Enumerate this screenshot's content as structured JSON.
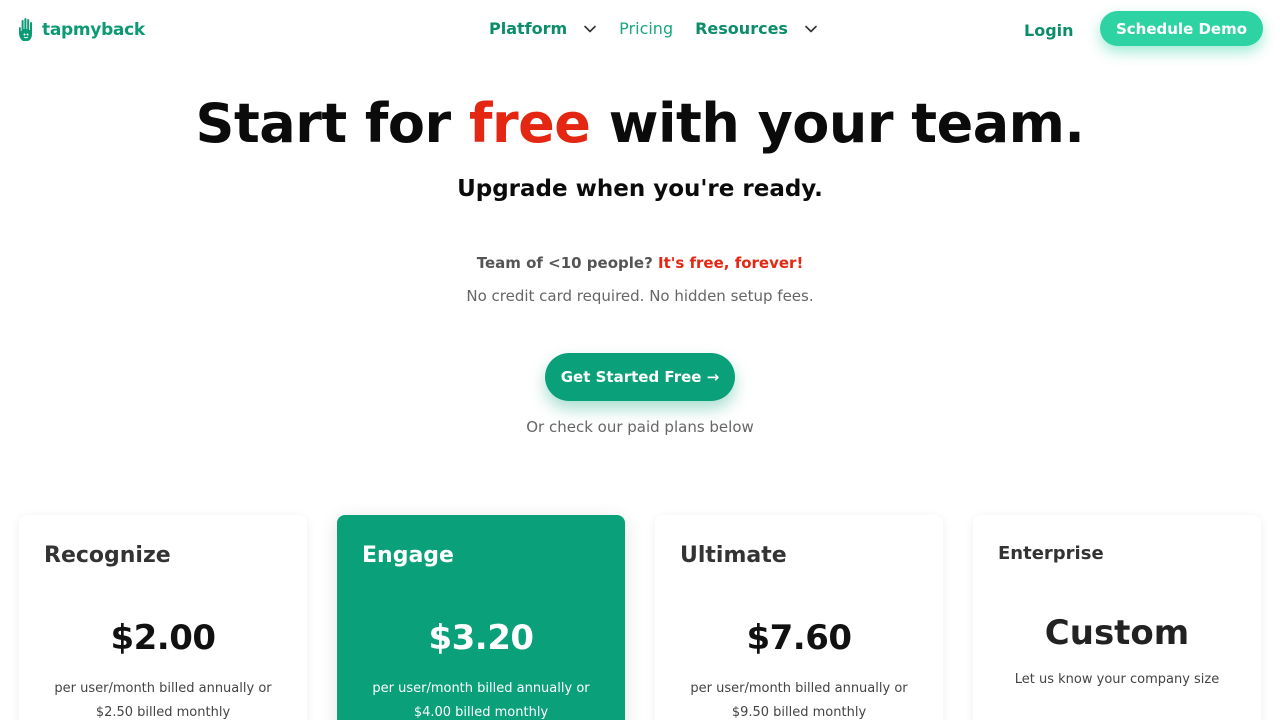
{
  "brand": {
    "name": "tapmyback",
    "logo_icon": "hand-icon",
    "accent_color": "#0aa07a",
    "highlight_color": "#e32712"
  },
  "nav": {
    "items": [
      {
        "label": "Platform",
        "has_dropdown": true
      },
      {
        "label": "Pricing",
        "has_dropdown": false
      },
      {
        "label": "Resources",
        "has_dropdown": true
      }
    ],
    "login_label": "Login",
    "demo_label": "Schedule Demo"
  },
  "hero": {
    "title_before": "Start for ",
    "title_highlight": "free",
    "title_after": " with your team.",
    "subtitle": "Upgrade when you're ready.",
    "team_question": "Team of <10 people?",
    "team_answer": "It's free, forever!",
    "no_cc": "No credit card required. No hidden setup fees.",
    "cta_label": "Get Started Free →",
    "or_check": "Or check our paid plans below"
  },
  "plans": [
    {
      "name": "Recognize",
      "price": "$2.00",
      "note_line1": "per user/month billed annually or",
      "note_line2": "$2.50 billed monthly"
    },
    {
      "name": "Engage",
      "price": "$3.20",
      "note_line1": "per user/month billed annually or",
      "note_line2": "$4.00 billed monthly"
    },
    {
      "name": "Ultimate",
      "price": "$7.60",
      "note_line1": "per user/month billed annually or",
      "note_line2": "$9.50 billed monthly"
    },
    {
      "name": "Enterprise",
      "price": "Custom",
      "note_line1": "Let us know your company size"
    }
  ]
}
